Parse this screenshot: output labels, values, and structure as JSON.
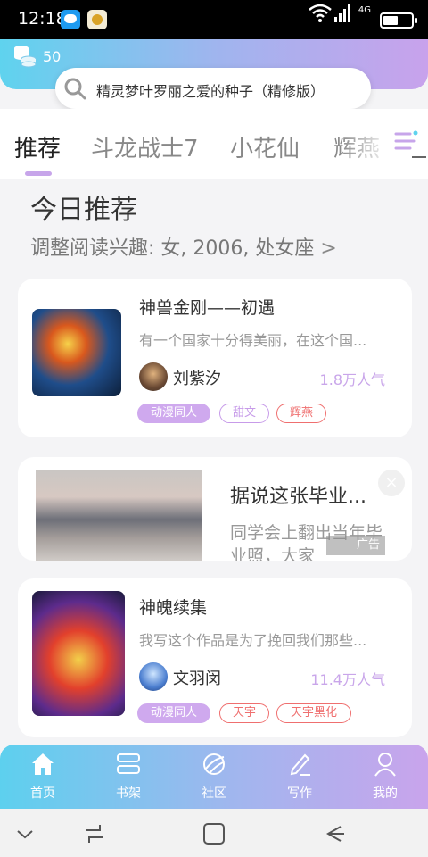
{
  "status_bar": {
    "time": "12:18",
    "network": "4G"
  },
  "header": {
    "coin_count": "50",
    "search_placeholder": "精灵梦叶罗丽之爱的种子（精修版）"
  },
  "tabs": [
    {
      "label": "推荐",
      "active": true
    },
    {
      "label": "斗龙战士7",
      "active": false
    },
    {
      "label": "小花仙",
      "active": false
    },
    {
      "label": "辉燕",
      "active": false
    }
  ],
  "today": {
    "title": "今日推荐",
    "subtitle": "调整阅读兴趣: 女, 2006, 处女座",
    "chevron": ">"
  },
  "books": [
    {
      "title": "神兽金刚——初遇",
      "description": "有一个国家十分得美丽，在这个国...",
      "author": "刘紫汐",
      "popularity": "1.8万人气",
      "tags": [
        {
          "label": "动漫同人",
          "style": "filled"
        },
        {
          "label": "甜文",
          "style": "purple"
        },
        {
          "label": "辉燕",
          "style": "red"
        }
      ]
    },
    {
      "title": "神魄续集",
      "description": "我写这个作品是为了挽回我们那些...",
      "author": "文羽闵",
      "popularity": "11.4万人气",
      "tags": [
        {
          "label": "动漫同人",
          "style": "filled"
        },
        {
          "label": "天宇",
          "style": "red"
        },
        {
          "label": "天宇黑化",
          "style": "red"
        }
      ]
    }
  ],
  "ad": {
    "title": "据说这张毕业...",
    "description": "同学会上翻出当年毕业照，大家",
    "badge": "广告",
    "close": "×"
  },
  "bottom_nav": [
    {
      "label": "首页",
      "icon": "home-icon"
    },
    {
      "label": "书架",
      "icon": "bookshelf-icon"
    },
    {
      "label": "社区",
      "icon": "community-icon"
    },
    {
      "label": "写作",
      "icon": "write-icon"
    },
    {
      "label": "我的",
      "icon": "profile-icon"
    }
  ],
  "colors": {
    "accent_purple": "#c9a6ea",
    "tag_red": "#ef6f6f",
    "gradient_start": "#5fd3ee",
    "gradient_end": "#c8a2ec"
  }
}
